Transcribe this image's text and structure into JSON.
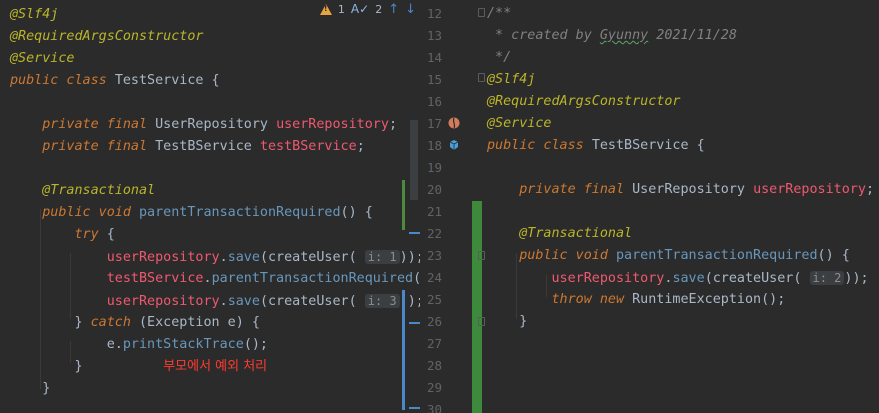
{
  "left": {
    "lines": [
      {
        "parts": [
          [
            "ann",
            "@Slf4j"
          ]
        ]
      },
      {
        "parts": [
          [
            "ann",
            "@RequiredArgsConstructor"
          ]
        ]
      },
      {
        "parts": [
          [
            "ann",
            "@Service"
          ]
        ]
      },
      {
        "parts": [
          [
            "kw",
            "public class "
          ],
          [
            "",
            "TestService {"
          ]
        ]
      },
      {
        "parts": []
      },
      {
        "parts": [
          [
            "",
            "    "
          ],
          [
            "kw",
            "private final "
          ],
          [
            "",
            "UserRepository "
          ],
          [
            "fld",
            "userRepository"
          ],
          [
            "",
            ";"
          ]
        ]
      },
      {
        "parts": [
          [
            "",
            "    "
          ],
          [
            "kw",
            "private final "
          ],
          [
            "",
            "TestBService "
          ],
          [
            "fld",
            "testBService"
          ],
          [
            "",
            ";"
          ]
        ]
      },
      {
        "parts": []
      },
      {
        "parts": [
          [
            "",
            "    "
          ],
          [
            "ann",
            "@Transactional"
          ]
        ]
      },
      {
        "parts": [
          [
            "",
            "    "
          ],
          [
            "kw",
            "public void "
          ],
          [
            "meth",
            "parentTransactionRequired"
          ],
          [
            "",
            "() {"
          ]
        ]
      },
      {
        "parts": [
          [
            "",
            "        "
          ],
          [
            "kw",
            "try "
          ],
          [
            "",
            "{"
          ]
        ]
      },
      {
        "parts": [
          [
            "",
            "            "
          ],
          [
            "fld",
            "userRepository"
          ],
          [
            "",
            "."
          ],
          [
            "meth",
            "save"
          ],
          [
            "",
            "(createUser( "
          ],
          [
            "hint",
            "i: 1"
          ],
          [
            "",
            "));"
          ]
        ]
      },
      {
        "parts": [
          [
            "",
            "            "
          ],
          [
            "fld",
            "testBService"
          ],
          [
            "",
            "."
          ],
          [
            "meth",
            "parentTransactionRequired"
          ],
          [
            "",
            "();"
          ]
        ]
      },
      {
        "parts": [
          [
            "",
            "            "
          ],
          [
            "fld",
            "userRepository"
          ],
          [
            "",
            "."
          ],
          [
            "meth",
            "save"
          ],
          [
            "",
            "(createUser( "
          ],
          [
            "hint",
            "i: 3"
          ],
          [
            "",
            "));"
          ]
        ]
      },
      {
        "parts": [
          [
            "",
            "        } "
          ],
          [
            "kw",
            "catch "
          ],
          [
            "",
            "(Exception e) {"
          ]
        ]
      },
      {
        "parts": [
          [
            "",
            "            e."
          ],
          [
            "meth",
            "printStackTrace"
          ],
          [
            "",
            "();"
          ]
        ]
      },
      {
        "parts": [
          [
            "",
            "        }          "
          ],
          [
            "red",
            "부모에서 예외 처리"
          ]
        ]
      },
      {
        "parts": [
          [
            "",
            "    }"
          ]
        ]
      }
    ]
  },
  "right": {
    "line_numbers": [
      "12",
      "13",
      "14",
      "15",
      "16",
      "17",
      "18",
      "19",
      "20",
      "21",
      "22",
      "23",
      "24",
      "25",
      "26",
      "27",
      "28",
      "29",
      "30"
    ],
    "lines": [
      {
        "parts": [
          [
            "cmt",
            "/**"
          ]
        ]
      },
      {
        "parts": [
          [
            "cmt",
            " * created by "
          ],
          [
            "cmt-sq",
            "Gyunny"
          ],
          [
            "cmt",
            " 2021/11/28"
          ]
        ]
      },
      {
        "parts": [
          [
            "cmt",
            " */"
          ]
        ]
      },
      {
        "parts": [
          [
            "ann",
            "@Slf4j"
          ]
        ]
      },
      {
        "parts": [
          [
            "ann",
            "@RequiredArgsConstructor"
          ]
        ]
      },
      {
        "parts": [
          [
            "ann",
            "@Service"
          ]
        ]
      },
      {
        "parts": [
          [
            "kw",
            "public class "
          ],
          [
            "",
            "TestBService {"
          ]
        ]
      },
      {
        "parts": []
      },
      {
        "parts": [
          [
            "",
            "    "
          ],
          [
            "kw",
            "private final "
          ],
          [
            "",
            "UserRepository "
          ],
          [
            "fld",
            "userRepository"
          ],
          [
            "",
            ";"
          ]
        ]
      },
      {
        "parts": []
      },
      {
        "parts": [
          [
            "",
            "    "
          ],
          [
            "ann",
            "@Transactional"
          ]
        ]
      },
      {
        "parts": [
          [
            "",
            "    "
          ],
          [
            "kw",
            "public void "
          ],
          [
            "meth",
            "parentTransactionRequired"
          ],
          [
            "",
            "() {"
          ]
        ]
      },
      {
        "parts": [
          [
            "",
            "        "
          ],
          [
            "fld",
            "userRepository"
          ],
          [
            "",
            "."
          ],
          [
            "meth",
            "save"
          ],
          [
            "",
            "(createUser( "
          ],
          [
            "hint",
            "i: 2"
          ],
          [
            "",
            "));"
          ]
        ]
      },
      {
        "parts": [
          [
            "",
            "        "
          ],
          [
            "kw",
            "throw new "
          ],
          [
            "",
            "RuntimeException();"
          ]
        ]
      },
      {
        "parts": [
          [
            "",
            "    }"
          ]
        ]
      },
      {
        "parts": []
      },
      {
        "parts": []
      },
      {
        "parts": []
      },
      {
        "parts": []
      }
    ]
  },
  "warnings": {
    "warn_count": "1",
    "typo_count": "2",
    "typo_icon": "A✓"
  },
  "colors": {
    "annotation": "#bbb529",
    "keyword": "#cc7832",
    "field": "#ef596f",
    "method": "#6897bb",
    "comment": "#808080",
    "red_note": "#ff3b30"
  }
}
